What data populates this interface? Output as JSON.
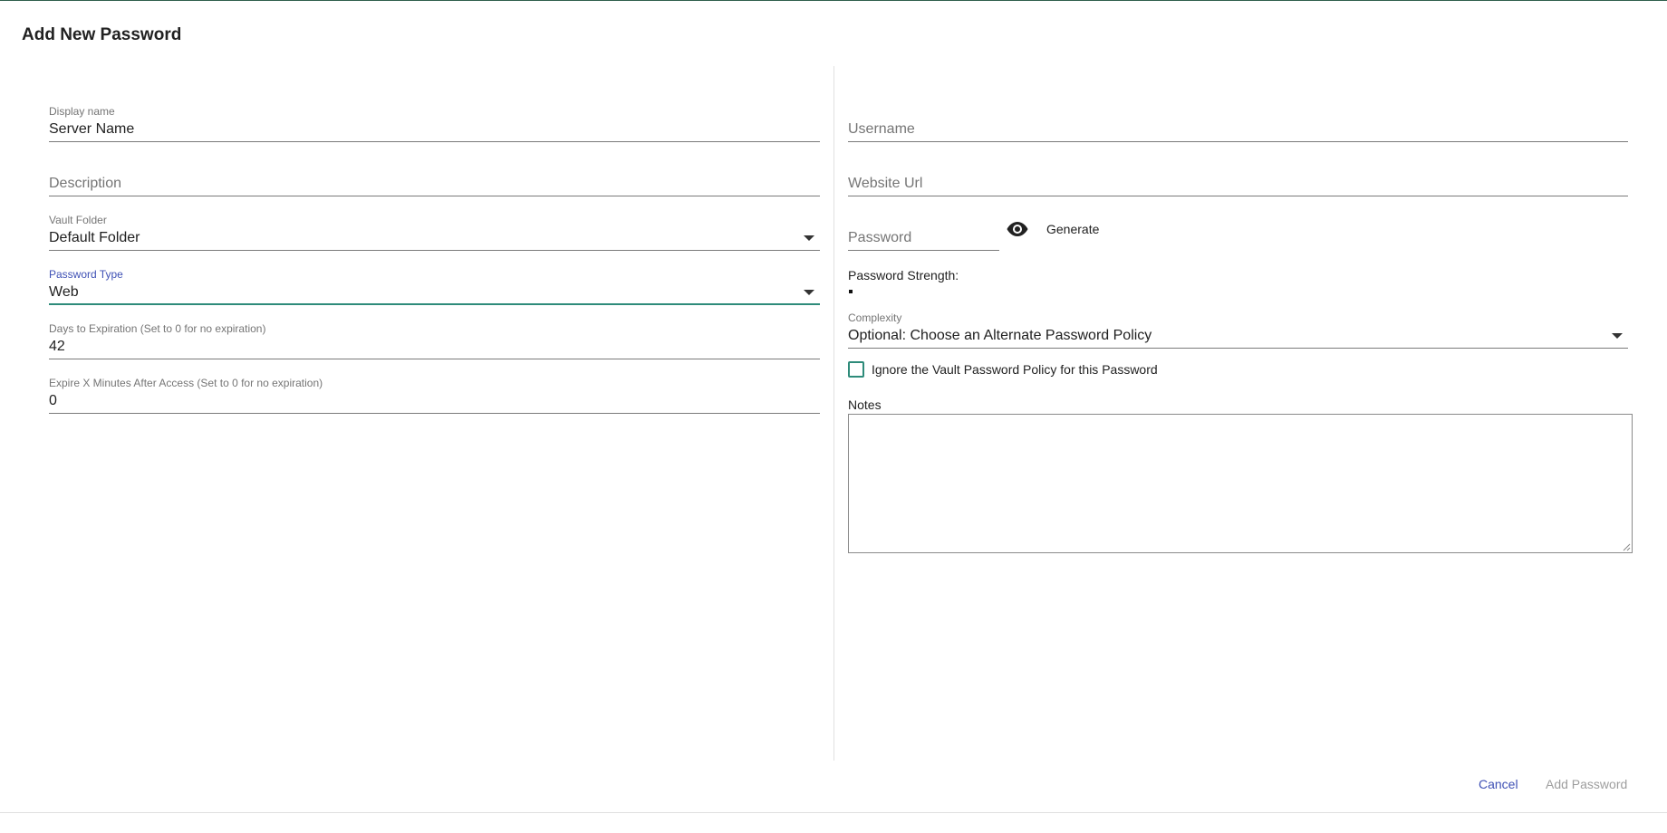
{
  "dialog": {
    "title": "Add New Password"
  },
  "left": {
    "display_name": {
      "label": "Display name",
      "value": "Server Name"
    },
    "description": {
      "placeholder": "Description"
    },
    "vault_folder": {
      "label": "Vault Folder",
      "value": "Default Folder"
    },
    "password_type": {
      "label": "Password Type",
      "value": "Web"
    },
    "days_to_expiration": {
      "label": "Days to Expiration (Set to 0 for no expiration)",
      "value": "42"
    },
    "expire_minutes": {
      "label": "Expire X Minutes After Access (Set to 0 for no expiration)",
      "value": "0"
    }
  },
  "right": {
    "username": {
      "placeholder": "Username"
    },
    "website_url": {
      "placeholder": "Website Url"
    },
    "password": {
      "placeholder": "Password",
      "visibility_icon": "eye-icon",
      "generate_label": "Generate"
    },
    "strength": {
      "label": "Password Strength:",
      "level": 0.0
    },
    "complexity": {
      "label": "Complexity",
      "value": "Optional: Choose an Alternate Password Policy"
    },
    "ignore_policy": {
      "label": "Ignore the Vault Password Policy for this Password",
      "checked": false
    },
    "notes": {
      "label": "Notes",
      "value": ""
    }
  },
  "actions": {
    "cancel_label": "Cancel",
    "add_label": "Add Password"
  },
  "colors": {
    "accent_teal": "#2e8b7a",
    "primary_indigo": "#3f51b5",
    "disabled_grey": "#9e9e9e"
  }
}
